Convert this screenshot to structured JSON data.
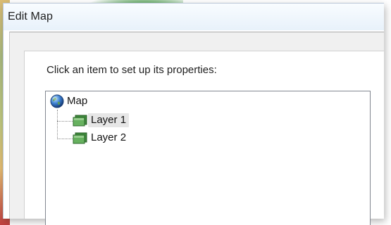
{
  "window": {
    "title": "Edit Map"
  },
  "dialog": {
    "instruction": "Click an item to set up its properties:"
  },
  "tree": {
    "root": {
      "label": "Map",
      "icon": "globe-icon"
    },
    "children": [
      {
        "label": "Layer 1",
        "icon": "layer-icon",
        "selected": true
      },
      {
        "label": "Layer 2",
        "icon": "layer-icon",
        "selected": false
      }
    ]
  },
  "colors": {
    "selection": "#e6e6e6",
    "layer_icon_green": "#4f9a4a",
    "globe_blue": "#2a63b8",
    "tree_border": "#828790"
  }
}
